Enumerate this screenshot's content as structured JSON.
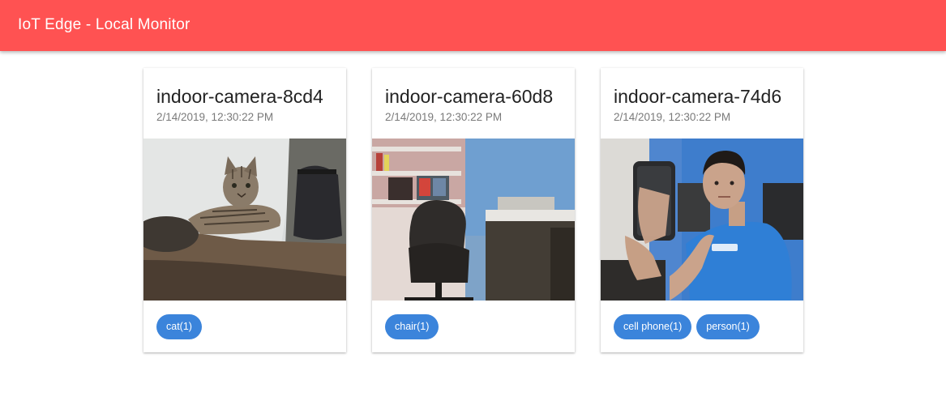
{
  "app": {
    "title": "IoT Edge - Local Monitor"
  },
  "colors": {
    "header": "#ff5252",
    "chip": "#3b84db"
  },
  "cards": [
    {
      "title": "indoor-camera-8cd4",
      "timestamp": "2/14/2019, 12:30:22 PM",
      "image": "cat-on-desk-photo",
      "chips": [
        {
          "label": "cat(1)"
        }
      ]
    },
    {
      "title": "indoor-camera-60d8",
      "timestamp": "2/14/2019, 12:30:22 PM",
      "image": "office-chair-photo",
      "chips": [
        {
          "label": "chair(1)"
        }
      ]
    },
    {
      "title": "indoor-camera-74d6",
      "timestamp": "2/14/2019, 12:30:22 PM",
      "image": "person-with-phone-photo",
      "chips": [
        {
          "label": "cell phone(1)"
        },
        {
          "label": "person(1)"
        }
      ]
    }
  ]
}
